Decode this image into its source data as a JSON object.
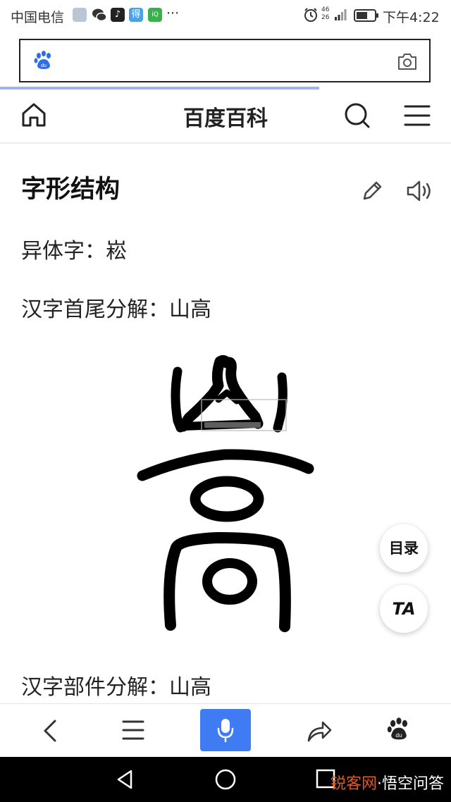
{
  "status_bar": {
    "carrier": "中国电信",
    "network": "46 26",
    "time": "下午4:22",
    "more": "···"
  },
  "header": {
    "title": "百度百科"
  },
  "section": {
    "title": "字形结构",
    "variant_label": "异体字：崧",
    "head_tail_label": "汉字首尾分解：山高",
    "component_label": "汉字部件分解：山高"
  },
  "floating": {
    "toc_label": "目录",
    "font_label": "TA"
  },
  "watermark": {
    "accent": "锐客网",
    "rest": "·悟空问答"
  },
  "icons": {
    "search_logo": "baidu-paw-icon",
    "camera": "camera-icon",
    "home": "home-icon",
    "search": "search-icon",
    "menu": "menu-icon",
    "edit": "pencil-icon",
    "speaker": "speaker-icon",
    "back": "chevron-left-icon",
    "list": "list-icon",
    "mic": "microphone-icon",
    "share": "share-icon",
    "paw": "baidu-paw-icon"
  },
  "colors": {
    "accent_blue": "#3f7bf3",
    "progress": "#9db4ec"
  }
}
